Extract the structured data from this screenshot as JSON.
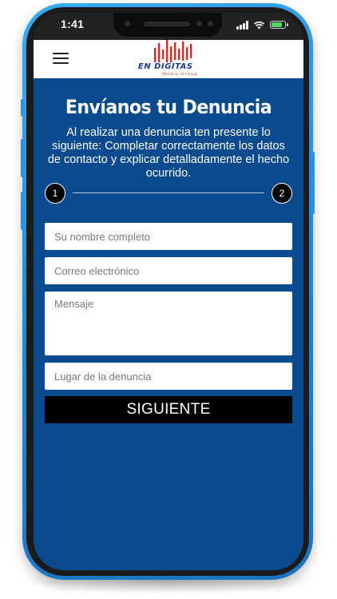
{
  "status_bar": {
    "time": "1:41",
    "battery_color": "#4cd964"
  },
  "header": {
    "menu_icon": "hamburger-icon",
    "logo": {
      "name": "EN DIGITAS",
      "tagline": "Media Group",
      "bar_color": "#d42a2a",
      "text_color": "#1a3a8f"
    }
  },
  "form": {
    "title": "Envíanos tu Denuncia",
    "description": "Al realizar una denuncia ten presente lo siguiente: Completar correctamente los datos de contacto y explicar detalladamente el hecho ocurrido.",
    "steps": [
      "1",
      "2"
    ],
    "current_step": 1,
    "name_placeholder": "Su nombre completo",
    "email_placeholder": "Correo electrónico",
    "message_placeholder": "Mensaje",
    "location_placeholder": "Lugar de la denuncia",
    "submit_label": "SIGUIENTE"
  },
  "colors": {
    "screen_background": "#0a4a8e",
    "frame": "#1f86d6",
    "button": "#000000"
  }
}
